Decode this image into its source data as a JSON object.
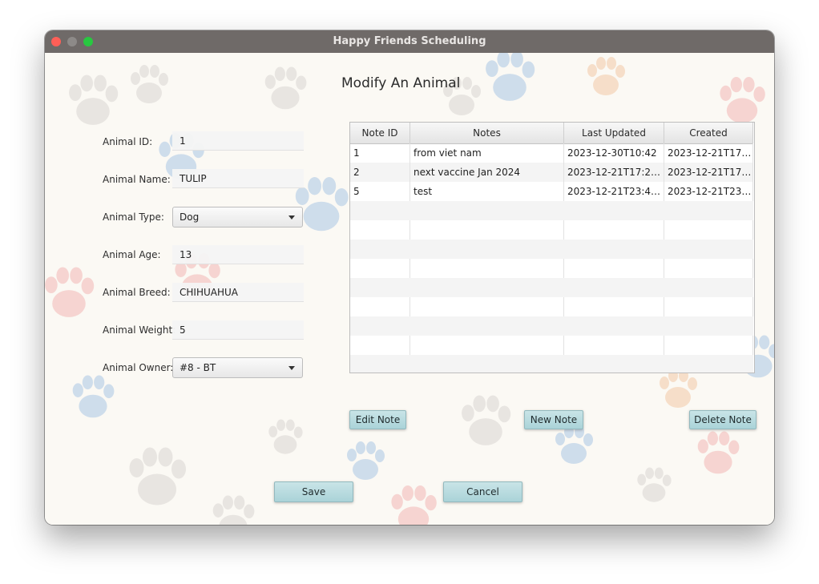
{
  "window": {
    "title": "Happy Friends Scheduling"
  },
  "heading": "Modify An Animal",
  "form": {
    "animal_id": {
      "label": "Animal ID:",
      "value": "1"
    },
    "animal_name": {
      "label": "Animal Name:",
      "value": "TULIP"
    },
    "animal_type": {
      "label": "Animal Type:",
      "value": "Dog"
    },
    "animal_age": {
      "label": "Animal Age:",
      "value": "13"
    },
    "animal_breed": {
      "label": "Animal Breed:",
      "value": "CHIHUAHUA"
    },
    "animal_weight": {
      "label": "Animal Weight:",
      "value": "5"
    },
    "animal_owner": {
      "label": "Animal Owner:",
      "value": "#8 - BT"
    }
  },
  "notes_table": {
    "columns": [
      "Note ID",
      "Notes",
      "Last Updated",
      "Created"
    ],
    "rows": [
      [
        "1",
        "from viet nam",
        "2023-12-30T10:42",
        "2023-12-21T17:…"
      ],
      [
        "2",
        "next vaccine Jan 2024",
        "2023-12-21T17:27:…",
        "2023-12-21T17:…"
      ],
      [
        "5",
        "test",
        "2023-12-21T23:4…",
        "2023-12-21T23…"
      ]
    ]
  },
  "buttons": {
    "edit_note": "Edit Note",
    "new_note": "New Note",
    "delete_note": "Delete Note",
    "save": "Save",
    "cancel": "Cancel"
  },
  "colors": {
    "titlebar": "#6f6a68",
    "button": "#aad3d8",
    "paw_blue": "#a9c6e4",
    "paw_pink": "#f2b7b4",
    "paw_orange": "#f3c9a6",
    "paw_grey": "#d9d6d2"
  },
  "icons": [
    "close-icon",
    "minimize-icon",
    "maximize-icon",
    "dropdown-arrow-icon",
    "paw-print-icon"
  ]
}
